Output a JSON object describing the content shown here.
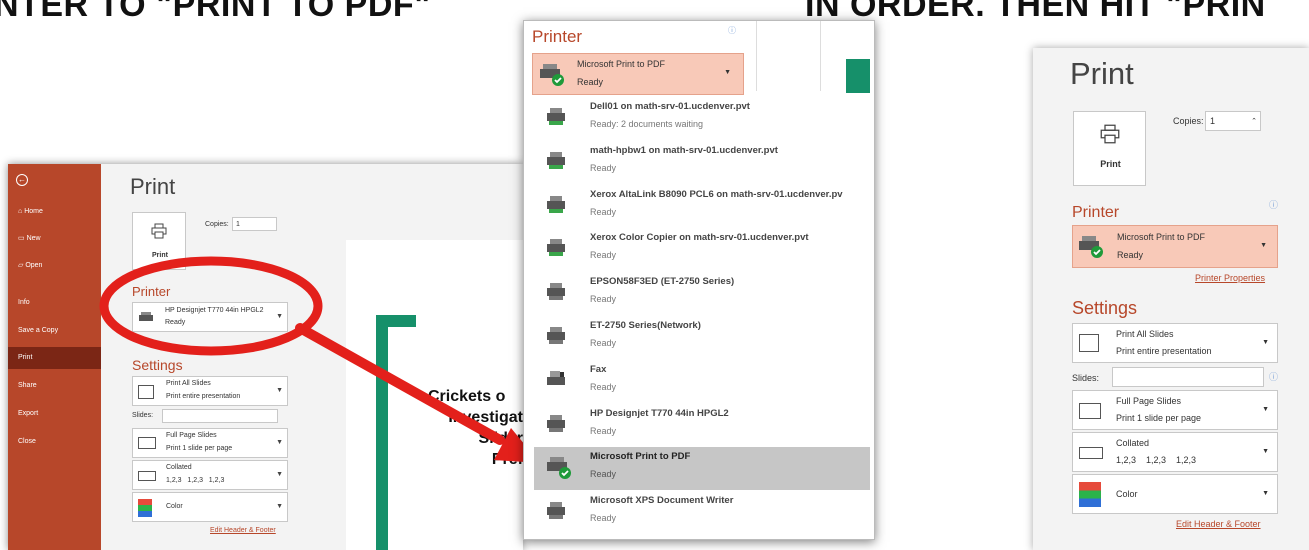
{
  "banner": {
    "left_text": "NTER TO \"PRINT TO PDF\"",
    "right_text": "IN ORDER. THEN HIT \"PRIN"
  },
  "colors": {
    "accent": "#b7472a",
    "backstage": "#b7472a",
    "arrow": "#e3201b",
    "highlight": "#f8c9b8"
  },
  "left": {
    "backstage": {
      "back_icon": "back-arrow-icon",
      "items": [
        {
          "label": "Home",
          "icon": "home-icon"
        },
        {
          "label": "New",
          "icon": "new-doc-icon"
        },
        {
          "label": "Open",
          "icon": "folder-icon"
        },
        {
          "label": "Info"
        },
        {
          "label": "Save a Copy"
        },
        {
          "label": "Print"
        },
        {
          "label": "Share"
        },
        {
          "label": "Export"
        },
        {
          "label": "Close"
        }
      ]
    },
    "title": "Print",
    "print_button": "Print",
    "copies_label": "Copies:",
    "copies_value": "1",
    "printer_header": "Printer",
    "printer_name": "HP Designjet T770 44in HPGL2",
    "printer_status": "Ready",
    "settings_header": "Settings",
    "settings": [
      {
        "line1": "Print All Slides",
        "line2": "Print entire presentation"
      },
      {
        "line1": "Full Page Slides",
        "line2": "Print 1 slide per page"
      },
      {
        "line1": "Collated",
        "line2": "1,2,3   1,2,3   1,2,3"
      },
      {
        "line1": "Color",
        "line2": ""
      }
    ],
    "slides_label": "Slides:",
    "footer_link": "Edit Header & Footer",
    "preview_lines": [
      "Crickets o",
      "Investigat",
      "Slider",
      "Pref"
    ]
  },
  "dropdown": {
    "header": "Printer",
    "selected_name": "Microsoft Print to PDF",
    "selected_status": "Ready",
    "items": [
      {
        "name": "Dell01 on math-srv-01.ucdenver.pvt",
        "status": "Ready: 2 documents waiting"
      },
      {
        "name": "math-hpbw1 on math-srv-01.ucdenver.pvt",
        "status": "Ready"
      },
      {
        "name": "Xerox AltaLink B8090 PCL6 on math-srv-01.ucdenver.pv",
        "status": "Ready"
      },
      {
        "name": "Xerox Color Copier on math-srv-01.ucdenver.pvt",
        "status": "Ready"
      },
      {
        "name": "EPSON58F3ED (ET-2750 Series)",
        "status": "Ready"
      },
      {
        "name": "ET-2750 Series(Network)",
        "status": "Ready"
      },
      {
        "name": "Fax",
        "status": "Ready"
      },
      {
        "name": "HP Designjet T770 44in HPGL2",
        "status": "Ready"
      },
      {
        "name": "Microsoft Print to PDF",
        "status": "Ready"
      },
      {
        "name": "Microsoft XPS Document Writer",
        "status": "Ready"
      }
    ]
  },
  "right": {
    "title": "Print",
    "print_button": "Print",
    "copies_label": "Copies:",
    "copies_value": "1",
    "printer_header": "Printer",
    "printer_name": "Microsoft Print to PDF",
    "printer_status": "Ready",
    "printer_properties": "Printer Properties",
    "settings_header": "Settings",
    "settings": [
      {
        "line1": "Print All Slides",
        "line2": "Print entire presentation"
      },
      {
        "line1": "Full Page Slides",
        "line2": "Print 1 slide per page"
      },
      {
        "line1": "Collated",
        "line2": "1,2,3    1,2,3    1,2,3"
      },
      {
        "line1": "Color",
        "line2": ""
      }
    ],
    "slides_label": "Slides:",
    "footer_link": "Edit Header & Footer"
  }
}
